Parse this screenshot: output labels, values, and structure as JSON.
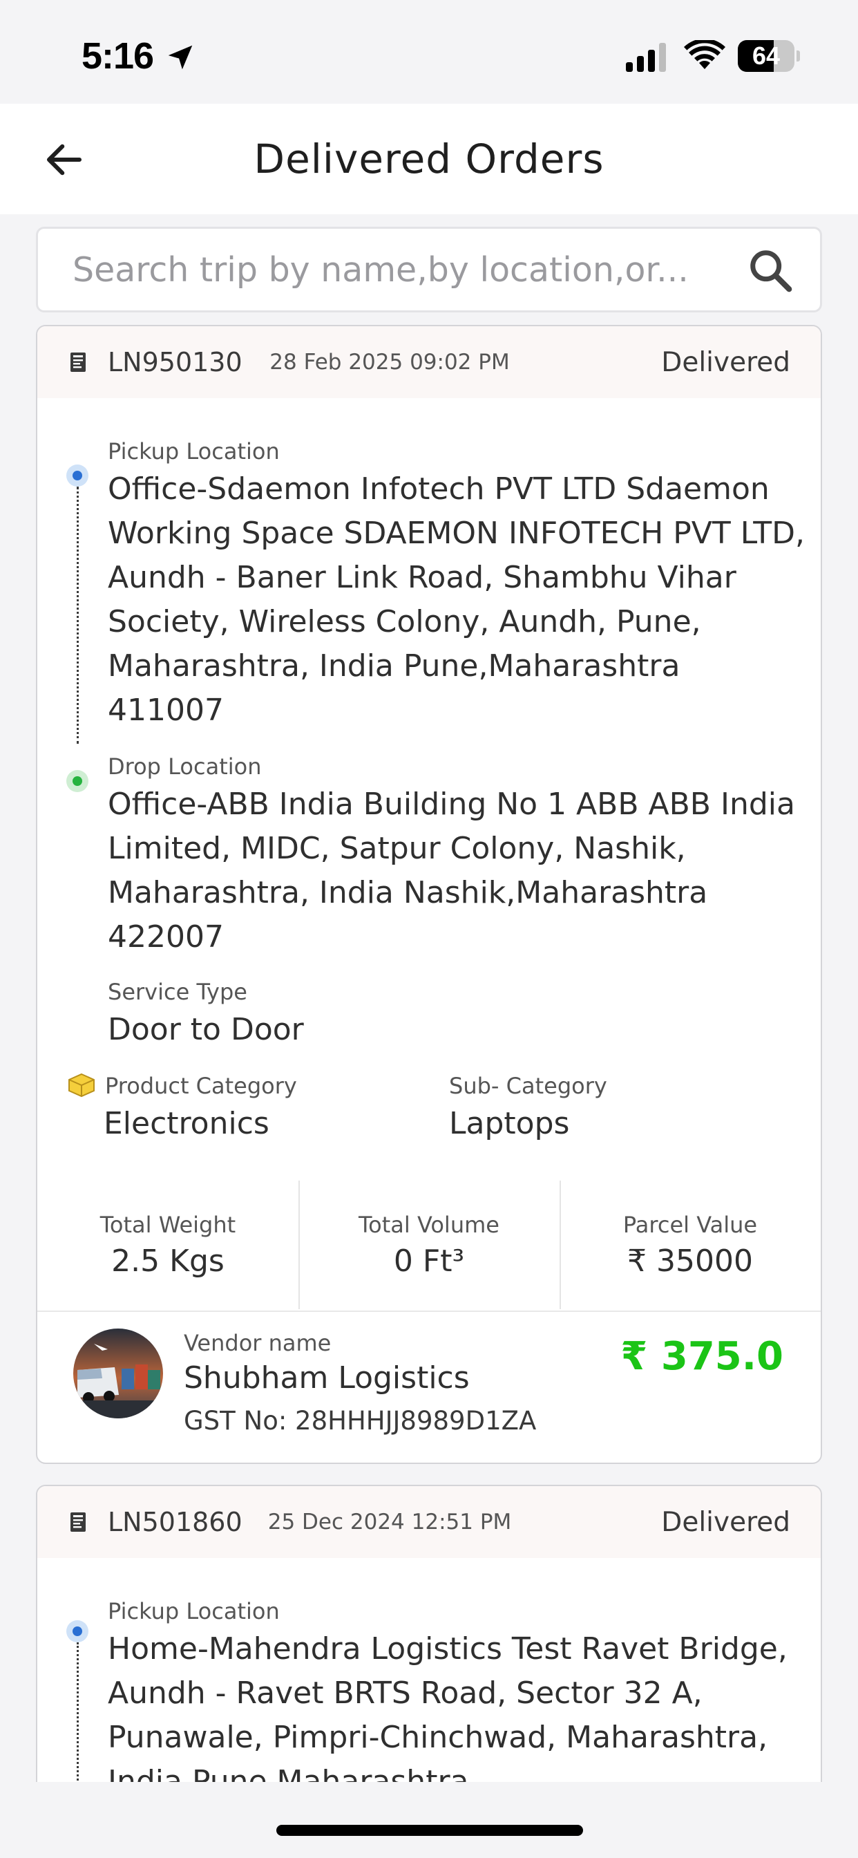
{
  "status_bar": {
    "time": "5:16",
    "battery": "64",
    "battery_level_percent": 64,
    "icons": [
      "location-arrow-icon",
      "cellular-signal-icon",
      "wifi-icon",
      "battery-icon"
    ]
  },
  "header": {
    "title": "Delivered Orders",
    "back_icon": "arrow-left-icon"
  },
  "search": {
    "placeholder": "Search trip by name,by location,or...",
    "value": "",
    "icon": "search-icon"
  },
  "orders": [
    {
      "id": "LN950130",
      "date": "28 Feb 2025 09:02 PM",
      "status": "Delivered",
      "pickup_label": "Pickup Location",
      "pickup": "Office-Sdaemon Infotech PVT LTD Sdaemon Working Space SDAEMON INFOTECH PVT LTD, Aundh - Baner Link Road, Shambhu Vihar Society, Wireless Colony, Aundh, Pune, Maharashtra, India Pune,Maharashtra 411007",
      "drop_label": "Drop Location",
      "drop": "Office-ABB India Building No 1 ABB ABB India Limited, MIDC, Satpur Colony, Nashik, Maharashtra, India Nashik,Maharashtra 422007",
      "service_type_label": "Service Type",
      "service_type": "Door to Door",
      "product_category_label": "Product Category",
      "product_category": "Electronics",
      "sub_category_label": "Sub- Category",
      "sub_category": "Laptops",
      "total_weight_label": "Total Weight",
      "total_weight": "2.5 Kgs",
      "total_volume_label": "Total Volume",
      "total_volume": "0 Ft³",
      "parcel_value_label": "Parcel Value",
      "parcel_value": "₹ 35000",
      "vendor_name_label": "Vendor name",
      "vendor_name": "Shubham Logistics",
      "gst": "GST No: 28HHHJJ8989D1ZA",
      "price": "₹ 375.0"
    },
    {
      "id": "LN501860",
      "date": "25 Dec 2024 12:51 PM",
      "status": "Delivered",
      "pickup_label": "Pickup Location",
      "pickup": "Home-Mahendra Logistics  Test Ravet Bridge, Aundh - Ravet BRTS Road, Sector 32 A, Punawale, Pimpri-Chinchwad, Maharashtra, India Pune,Maharashtra"
    }
  ],
  "colors": {
    "price": "#1bc416",
    "pickup_dot": "#2a6fd3",
    "drop_dot": "#26b33f",
    "card_header_bg": "#fbf7f6"
  }
}
